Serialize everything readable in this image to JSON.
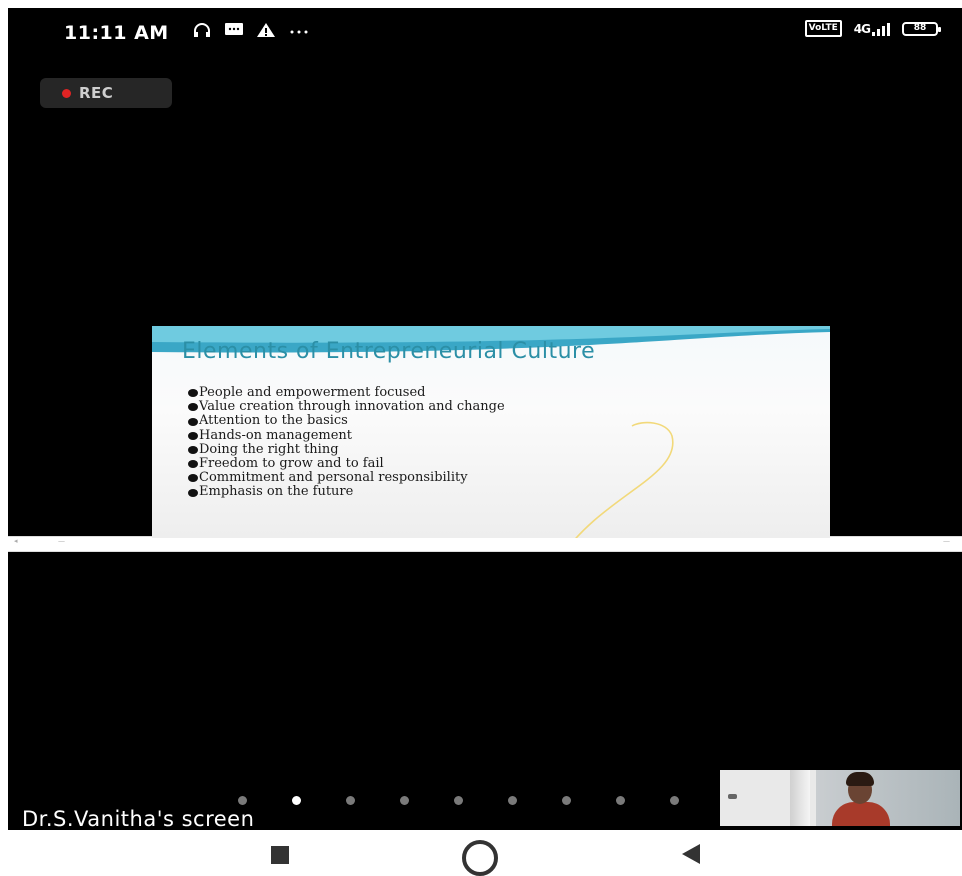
{
  "status_bar": {
    "time": "11:11 AM",
    "left_icons": [
      "headphones-icon",
      "message-icon",
      "warning-icon",
      "more-icon"
    ],
    "right_icons": [
      "volte-icon",
      "signal-icon",
      "battery-icon"
    ],
    "volte_label": "VoLTE",
    "signal_label": "4G",
    "battery_label": "88"
  },
  "recording": {
    "label": "REC",
    "dot_color": "#e02424"
  },
  "shared_content": {
    "slide_title": "Elements of Entrepreneurial Culture",
    "title_color": "#2b8fa6",
    "bullets": [
      "People and empowerment focused",
      "Value creation through innovation and change",
      "Attention to the basics",
      "Hands-on management",
      "Doing the right thing",
      "Freedom to grow and to fail",
      "Commitment and personal responsibility",
      "Emphasis on the future"
    ]
  },
  "presenter_label": "Dr.S.Vanitha's screen",
  "pagination": {
    "count": 9,
    "active_index": 1
  },
  "nav_bar": {
    "buttons": [
      "recents-button",
      "home-button",
      "back-button"
    ]
  }
}
